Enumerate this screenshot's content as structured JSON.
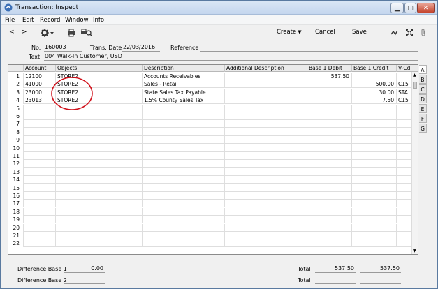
{
  "window": {
    "title": "Transaction: Inspect"
  },
  "menu": [
    "File",
    "Edit",
    "Record",
    "Window",
    "Info"
  ],
  "toolbar": {
    "create": "Create",
    "cancel": "Cancel",
    "save": "Save"
  },
  "header": {
    "no_label": "No.",
    "no_value": "160003",
    "date_label": "Trans. Date",
    "date_value": "22/03/2016",
    "ref_label": "Reference",
    "ref_value": "",
    "text_label": "Text",
    "text_value": "004 Walk-In Customer, USD"
  },
  "grid": {
    "columns": [
      "Account",
      "Objects",
      "Description",
      "Additional Description",
      "Base 1 Debit",
      "Base 1 Credit",
      "V-Cd"
    ],
    "rows": [
      {
        "n": "1",
        "account": "12100",
        "objects": "STORE2",
        "description": "Accounts Receivables",
        "additional": "",
        "debit": "537.50",
        "credit": "",
        "vcd": ""
      },
      {
        "n": "2",
        "account": "41000",
        "objects": "STORE2",
        "description": "Sales - Retail",
        "additional": "",
        "debit": "",
        "credit": "500.00",
        "vcd": "C15"
      },
      {
        "n": "3",
        "account": "23000",
        "objects": "STORE2",
        "description": "State Sales Tax Payable",
        "additional": "",
        "debit": "",
        "credit": "30.00",
        "vcd": "STA"
      },
      {
        "n": "4",
        "account": "23013",
        "objects": "STORE2",
        "description": "1.5% County Sales Tax",
        "additional": "",
        "debit": "",
        "credit": "7.50",
        "vcd": "C15"
      },
      {
        "n": "5"
      },
      {
        "n": "6"
      },
      {
        "n": "7"
      },
      {
        "n": "8"
      },
      {
        "n": "9"
      },
      {
        "n": "10"
      },
      {
        "n": "11"
      },
      {
        "n": "12"
      },
      {
        "n": "13"
      },
      {
        "n": "14"
      },
      {
        "n": "15"
      },
      {
        "n": "16"
      },
      {
        "n": "17"
      },
      {
        "n": "18"
      },
      {
        "n": "19"
      },
      {
        "n": "20"
      },
      {
        "n": "21"
      },
      {
        "n": "22"
      }
    ]
  },
  "tabs": [
    "A",
    "B",
    "C",
    "D",
    "E",
    "F",
    "G"
  ],
  "footer": {
    "diff1_label": "Difference Base 1",
    "diff1_value": "0.00",
    "diff2_label": "Difference Base 2",
    "diff2_value": "",
    "total_label": "Total",
    "total_debit": "537.50",
    "total_credit": "537.50",
    "total2_label": "Total",
    "total2_debit": "",
    "total2_credit": ""
  },
  "colors": {
    "annotation": "#d0101a",
    "titlebar": "#c4d6ee"
  }
}
